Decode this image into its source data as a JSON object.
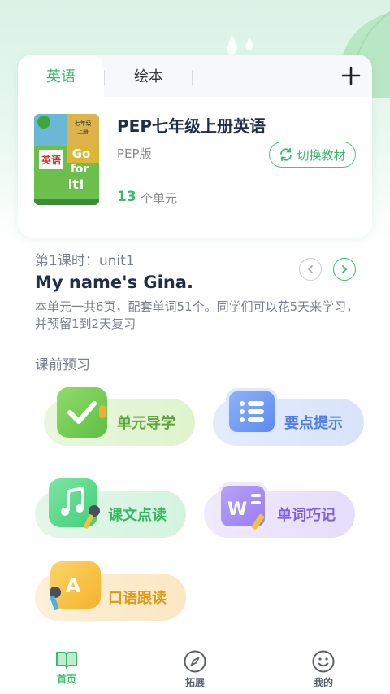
{
  "tabs": [
    {
      "label": "英语",
      "active": true
    },
    {
      "label": "绘本",
      "active": false
    }
  ],
  "add_icon": "plus-icon",
  "book": {
    "title": "PEP七年级上册英语",
    "edition": "PEP版",
    "switch_label": "切换教材",
    "unit_count": "13",
    "unit_label": "个单元",
    "cover_texts": {
      "subject": "英语",
      "grade": "七年级",
      "term": "上册",
      "slogan_1": "Go",
      "slogan_2": "for",
      "slogan_3": "it!"
    }
  },
  "lesson": {
    "label": "第1课时：unit1",
    "title": "My name's Gina.",
    "description": "本单元一共6页，配套单词51个。同学们可以花5天来学习，并预留1到2天复习"
  },
  "section_title": "课前预习",
  "features": [
    {
      "label": "单元导学",
      "icon": "checkmark-icon",
      "color": "#6cc54c"
    },
    {
      "label": "要点提示",
      "icon": "list-icon",
      "color": "#5b8af0"
    },
    {
      "label": "课文点读",
      "icon": "music-note-icon",
      "color": "#3fcf78"
    },
    {
      "label": "单词巧记",
      "icon": "word-w-icon",
      "color": "#9a7cf0"
    },
    {
      "label": "口语跟读",
      "icon": "letter-a-icon",
      "color": "#f5b32a"
    }
  ],
  "bottom_nav": [
    {
      "label": "首页",
      "icon": "book-icon",
      "active": true
    },
    {
      "label": "拓展",
      "icon": "compass-icon",
      "active": false
    },
    {
      "label": "我的",
      "icon": "smiley-icon",
      "active": false
    }
  ],
  "colors": {
    "accent": "#39b96a",
    "title": "#1f2f4a",
    "muted": "#7a7f8c"
  }
}
